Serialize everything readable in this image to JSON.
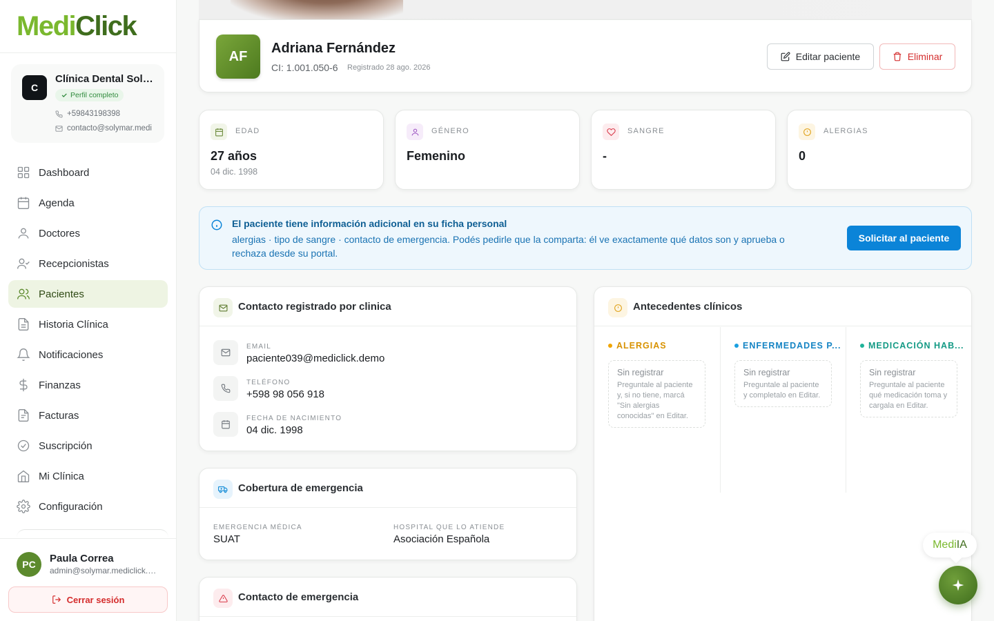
{
  "brand": {
    "part1": "Medi",
    "part2": "Click"
  },
  "clinic": {
    "initial": "C",
    "name": "Clínica Dental Solymar",
    "badge": "Perfil completo",
    "phone": "+59843198398",
    "email": "contacto@solymar.medi"
  },
  "nav": {
    "items": [
      {
        "label": "Dashboard",
        "icon": "grid-icon"
      },
      {
        "label": "Agenda",
        "icon": "calendar-icon"
      },
      {
        "label": "Doctores",
        "icon": "user-icon"
      },
      {
        "label": "Recepcionistas",
        "icon": "user-check-icon"
      },
      {
        "label": "Pacientes",
        "icon": "users-icon",
        "active": true
      },
      {
        "label": "Historia Clínica",
        "icon": "file-text-icon"
      },
      {
        "label": "Notificaciones",
        "icon": "bell-icon"
      },
      {
        "label": "Finanzas",
        "icon": "dollar-icon"
      },
      {
        "label": "Facturas",
        "icon": "receipt-icon"
      },
      {
        "label": "Suscripción",
        "icon": "check-circle-icon"
      },
      {
        "label": "Mi Clínica",
        "icon": "home-icon"
      },
      {
        "label": "Configuración",
        "icon": "gear-icon"
      }
    ]
  },
  "user": {
    "initials": "PC",
    "name": "Paula Correa",
    "email": "admin@solymar.mediclick.demo",
    "logout_label": "Cerrar sesión"
  },
  "patient": {
    "initials": "AF",
    "name": "Adriana Fernández",
    "ci": "CI: 1.001.050-6",
    "registered": "Registrado 28 ago. 2026",
    "edit_label": "Editar paciente",
    "delete_label": "Eliminar"
  },
  "stats": [
    {
      "label": "EDAD",
      "value": "27 años",
      "sub": "04 dic. 1998",
      "icon": "calendar-icon"
    },
    {
      "label": "GÉNERO",
      "value": "Femenino",
      "sub": "",
      "icon": "user-icon"
    },
    {
      "label": "SANGRE",
      "value": "-",
      "sub": "",
      "icon": "heart-icon"
    },
    {
      "label": "ALERGIAS",
      "value": "0",
      "sub": "",
      "icon": "alert-icon"
    }
  ],
  "info": {
    "title": "El paciente tiene información adicional en su ficha personal",
    "text": "alergias · tipo de sangre · contacto de emergencia. Podés pedirle que la comparta: él ve exactamente qué datos son y aprueba o rechaza desde su portal.",
    "button": "Solicitar al paciente"
  },
  "contact": {
    "title": "Contacto registrado por clinica",
    "rows": [
      {
        "label": "EMAIL",
        "value": "paciente039@mediclick.demo"
      },
      {
        "label": "TELÉFONO",
        "value": "+598 98 056 918"
      },
      {
        "label": "FECHA DE NACIMIENTO",
        "value": "04 dic. 1998"
      }
    ]
  },
  "coverage": {
    "title": "Cobertura de emergencia",
    "emergency_label": "EMERGENCIA MÉDICA",
    "emergency_value": "SUAT",
    "hospital_label": "HOSPITAL QUE LO ATIENDE",
    "hospital_value": "Asociación Española"
  },
  "emergency_contact": {
    "title": "Contacto de emergencia"
  },
  "antecedentes": {
    "title": "Antecedentes clínicos",
    "columns": [
      {
        "heading": "ALERGIAS",
        "status": "Sin registrar",
        "hint": "Preguntale al paciente y, si no tiene, marcá \"Sin alergias conocidas\" en Editar.",
        "color": "#f0a500"
      },
      {
        "heading": "ENFERMEDADES P...",
        "status": "Sin registrar",
        "hint": "Preguntale al paciente y completalo en Editar.",
        "color": "#1a9fe0"
      },
      {
        "heading": "MEDICACIÓN HAB...",
        "status": "Sin registrar",
        "hint": "Preguntale al paciente qué medicación toma y cargala en Editar.",
        "color": "#1fb39a"
      }
    ]
  },
  "assistant": {
    "label_part1": "Medi",
    "label_part2": "IA",
    "fab_icon": "sparkle-icon"
  },
  "colors": {
    "accent": "#7ab82e",
    "accent_dark": "#3f6d1d",
    "info": "#0b84d8",
    "danger": "#d42c2c"
  }
}
